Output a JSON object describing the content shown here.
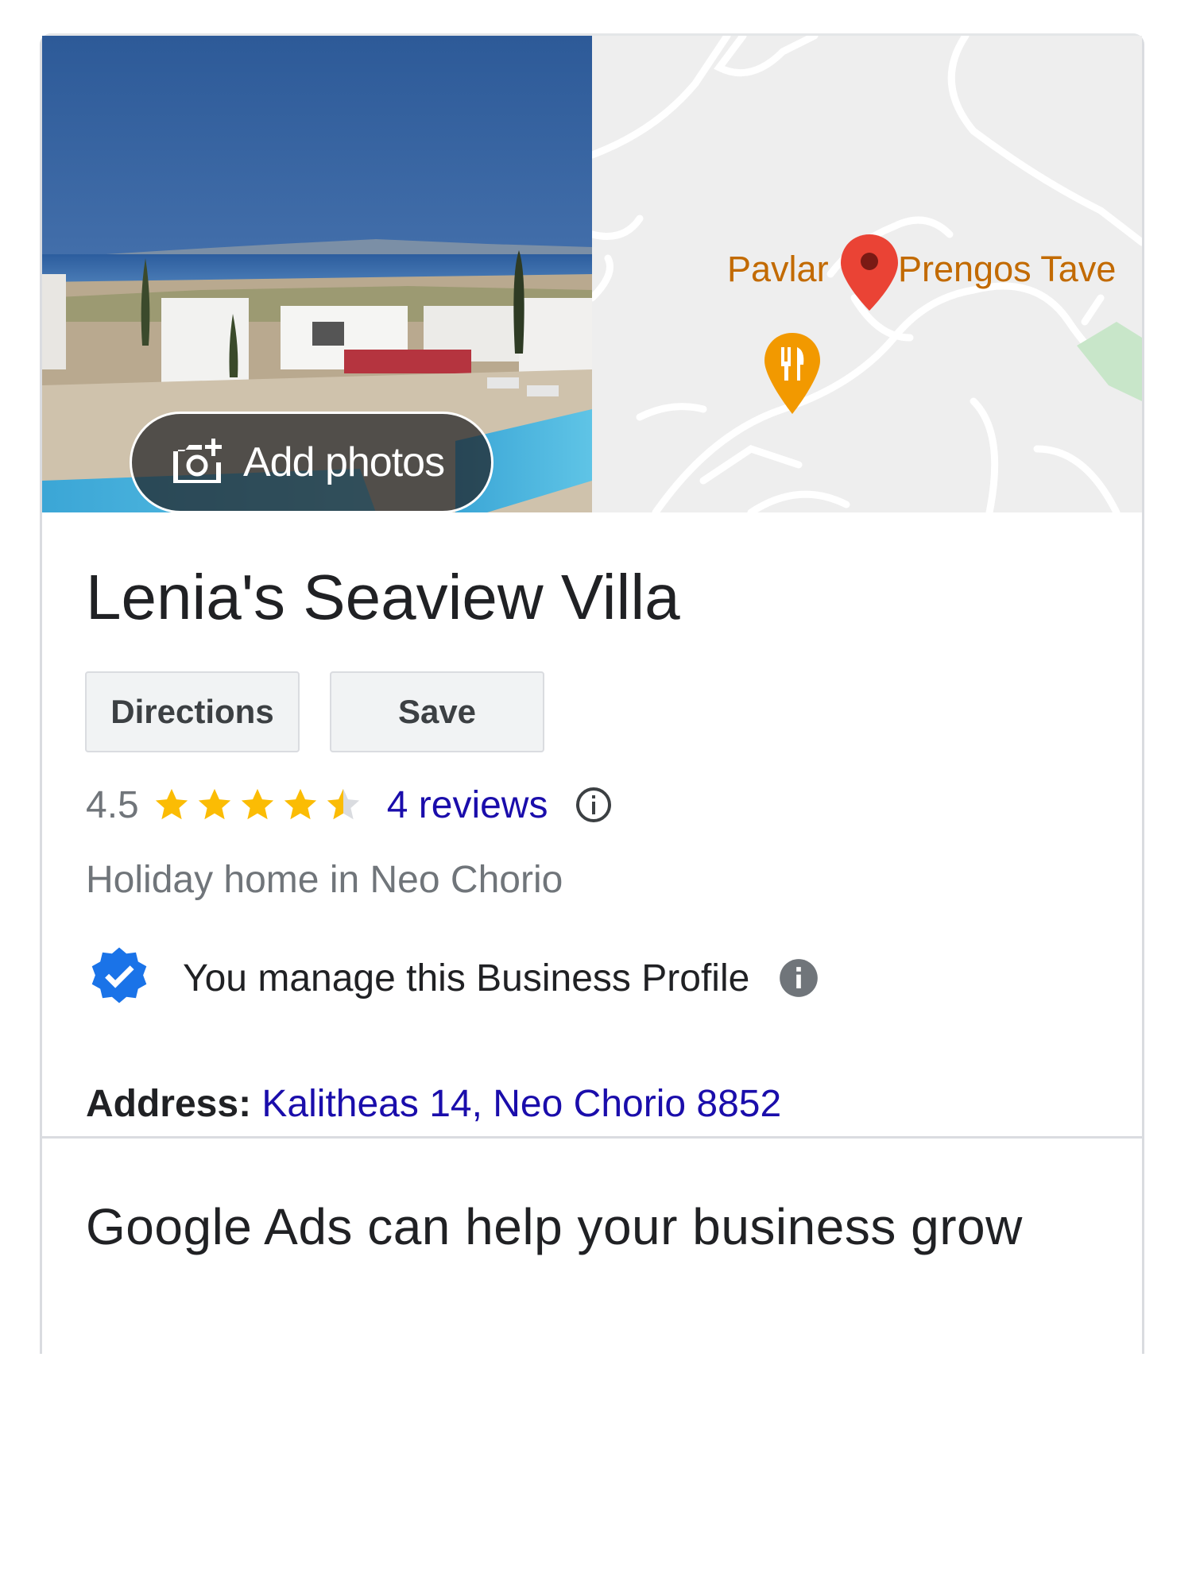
{
  "photo": {
    "add_photos_label": "Add photos"
  },
  "map": {
    "labels": {
      "left": "Pavlar",
      "right": "Prengos Tave"
    },
    "colors": {
      "pin": "#ea4335",
      "restaurant_pin": "#f29900",
      "label": "#c26a00",
      "road": "#ffffff",
      "land": "#eeeeee",
      "park": "#c8e6c9"
    }
  },
  "business": {
    "name": "Lenia's Seaview Villa",
    "buttons": {
      "directions": "Directions",
      "save": "Save"
    },
    "rating": {
      "value_text": "4.5",
      "value": 4.5,
      "max": 5,
      "reviews": "4 reviews"
    },
    "category": "Holiday home in Neo Chorio",
    "manage_text": "You manage this Business Profile",
    "address": {
      "label": "Address:",
      "value": "Kalitheas 14, Neo Chorio 8852"
    }
  },
  "ads": {
    "heading": "Google Ads can help your business grow"
  },
  "colors": {
    "link": "#1a0dab",
    "star": "#fbbc04",
    "badge": "#1a73e8",
    "muted": "#70757a"
  },
  "icons": [
    "add-photo-camera-icon",
    "map-pin-icon",
    "restaurant-pin-icon",
    "star-icon",
    "info-outline-icon",
    "verified-badge-icon",
    "info-filled-icon"
  ]
}
